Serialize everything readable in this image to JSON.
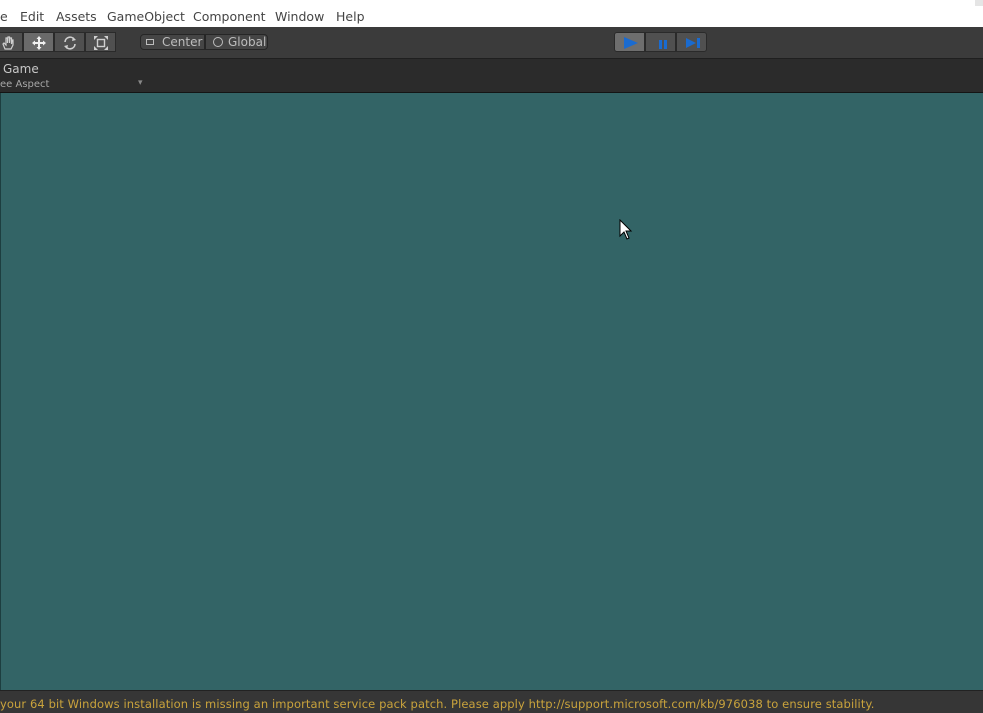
{
  "menubar": {
    "items": [
      {
        "label": "e"
      },
      {
        "label": "Edit"
      },
      {
        "label": "Assets"
      },
      {
        "label": "GameObject"
      },
      {
        "label": "Component"
      },
      {
        "label": "Window"
      },
      {
        "label": "Help"
      }
    ]
  },
  "toolbar": {
    "tools": [
      {
        "icon": "hand-icon"
      },
      {
        "icon": "move-arrows-icon"
      },
      {
        "icon": "rotate-icon"
      },
      {
        "icon": "scale-icon"
      }
    ],
    "pivot": {
      "label": "Center",
      "icon": "pivot-icon"
    },
    "space": {
      "label": "Global",
      "icon": "global-icon"
    },
    "playback": {
      "play_icon": "play-icon",
      "pause_icon": "pause-icon",
      "step_icon": "step-icon",
      "accent": "#1a6bd0"
    }
  },
  "game_view": {
    "tab_label": "Game",
    "aspect_label": "ee Aspect",
    "aspect_arrow": "▾",
    "background": "#336466"
  },
  "statusbar": {
    "message": "your 64 bit Windows installation is missing an important service pack patch. Please apply http://support.microsoft.com/kb/976038 to ensure stability.",
    "color": "#c9a33c"
  }
}
